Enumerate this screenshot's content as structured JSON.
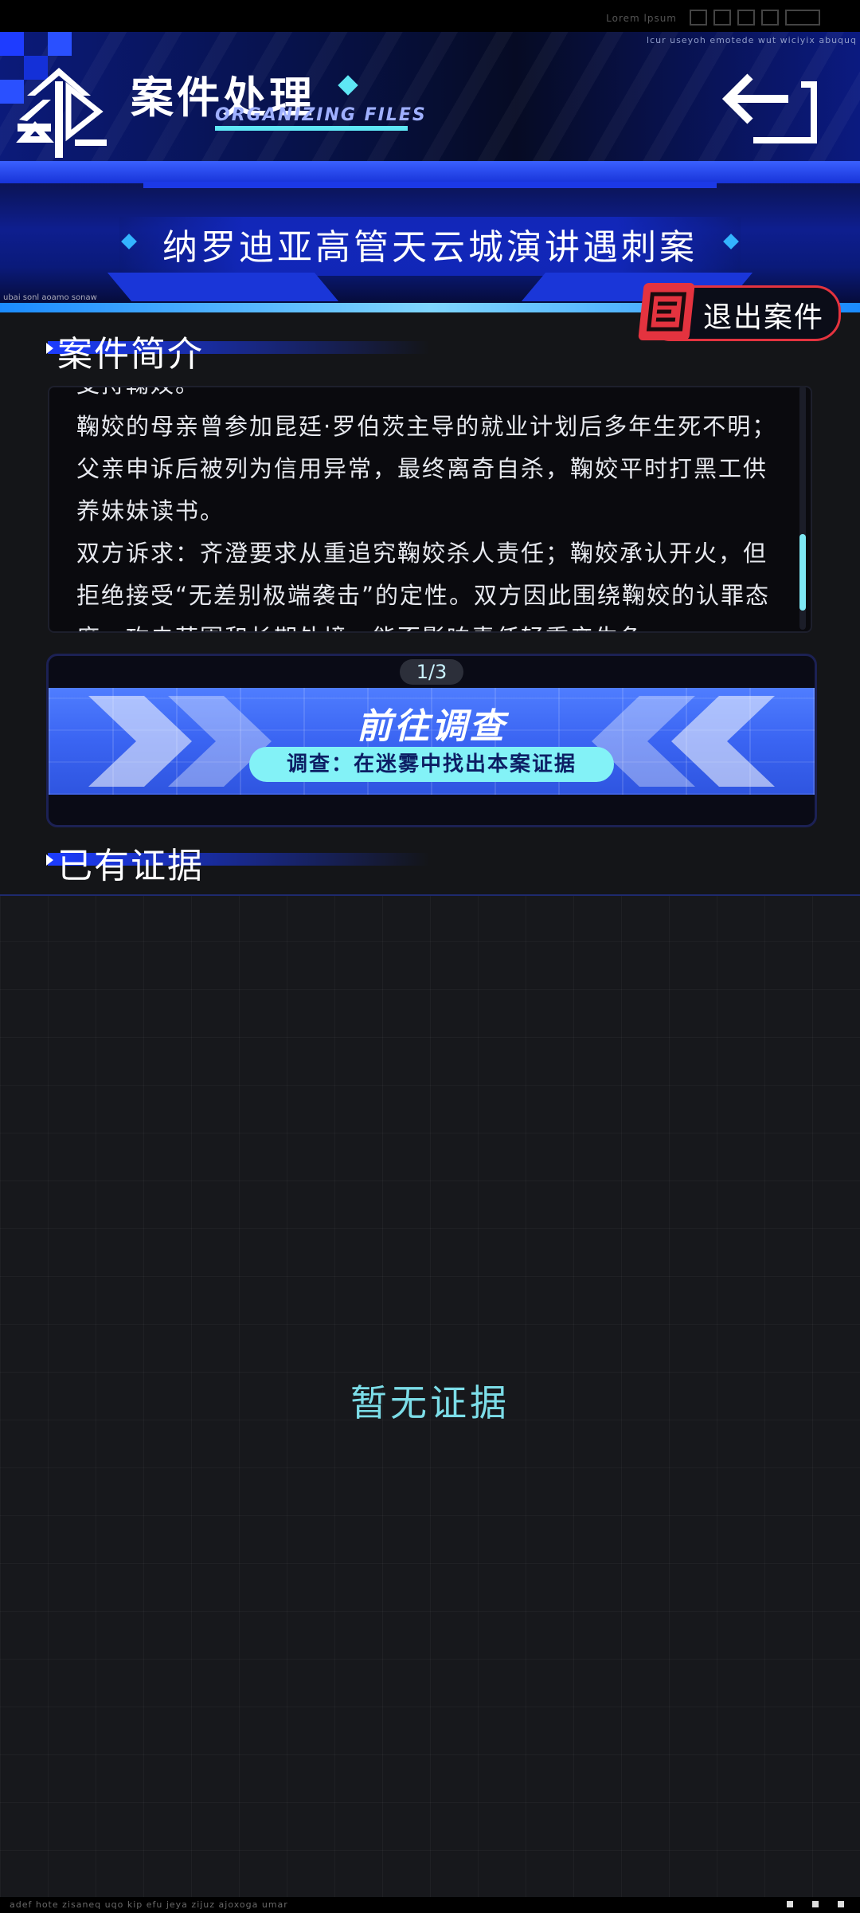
{
  "status_bar": {
    "micro_text": "Lorem lpsum"
  },
  "header": {
    "title": "案件处理",
    "subtitle_en": "ORGANIZING FILES",
    "micro_text": "lcur useyoh emotede wut wiciyix abuquq",
    "back_icon": "back-arrow-icon"
  },
  "case": {
    "title": "纳罗迪亚高管天云城演讲遇刺案",
    "banner_micro": "ubai sonl aoamo sonaw",
    "exit_button": {
      "label": "退出案件",
      "icon": "exit-case-icon"
    }
  },
  "brief": {
    "heading": "案件简介",
    "paragraphs": [
      "支持鞠姣。",
      "鞠姣的母亲曾参加昆廷·罗伯茨主导的就业计划后多年生死不明；父亲申诉后被列为信用异常，最终离奇自杀，鞠姣平时打黑工供养妹妹读书。",
      "双方诉求：齐澄要求从重追究鞠姣杀人责任；鞠姣承认开火，但拒绝接受“无差别极端袭击”的定性。双方因此围绕鞠姣的认罪态度、攻击范围和长期处境，能否影响责任轻重产生争"
    ]
  },
  "investigation": {
    "page": "1/3",
    "button_title": "前往调查",
    "button_sub": "调查：在迷雾中找出本案证据"
  },
  "evidence": {
    "heading": "已有证据",
    "empty_text": "暂无证据"
  },
  "footer": {
    "micro_text": "adef hote zisaneq uqo kip efu jeya zijuz ajoxoga umar"
  },
  "colors": {
    "accent_blue": "#1c3cff",
    "cyan": "#7cdde8",
    "danger_red": "#e4333f"
  }
}
